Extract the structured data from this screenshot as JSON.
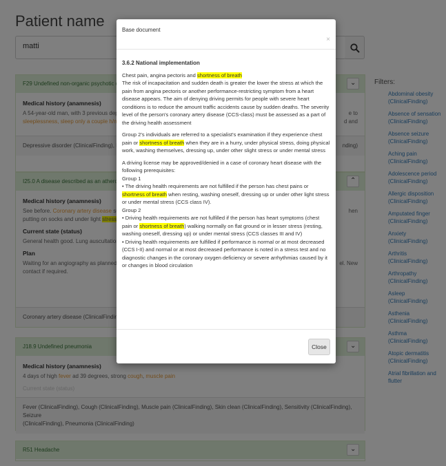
{
  "header": {
    "title": "Patient name"
  },
  "search": {
    "value": "matti"
  },
  "panels": [
    {
      "code": "F29 Undefined non-organic psychotic dis",
      "history_label": "Medical history (anamnesis)",
      "history_text_1": "A 54-year-old man, with 3 previous depre",
      "history_text_2": "sleeplessness, sleep only a couple h/nig",
      "history_tail_1": "e to",
      "history_tail_2": "d and",
      "findings_left": "Depressive disorder (ClinicalFinding), Ins",
      "findings_right": "nding)"
    },
    {
      "code": "I25.0 A disease described as an atheroc",
      "history_label": "Medical history (anamnesis)",
      "history_text_1a": "See before. ",
      "history_text_1b": "Coronary artery disease",
      "history_text_1c": " sus",
      "history_text_2a": "putting on socks and under light ",
      "history_text_2b": "stress",
      "history_text_2c": ". D",
      "history_tail_1": "hen",
      "status_label": "Current state (status)",
      "status_text": "General health good. Lung auscultation c",
      "plan_label": "Plan",
      "plan_text_1": "Waiting for an angiography as planned. S",
      "plan_text_2": "contact if required.",
      "plan_tail": "el. New",
      "findings_left": "Coronary artery disease (ClinicalFinding)"
    },
    {
      "code": "J18.9 Undefined pneumonia",
      "history_label": "Medical history (anamnesis)",
      "history_text_a": "4 days of high ",
      "history_text_fever": "fever",
      "history_text_b": " ad 39 degrees, strong ",
      "history_text_cough": "cough",
      "history_text_c": ", ",
      "history_text_muscle": "muscle pain",
      "status_label": "Current state (status)",
      "findings_1": "Fever (ClinicalFinding), Cough (ClinicalFinding), Muscle pain (ClinicalFinding), Skin clean (ClinicalFinding), Sensitivity (ClinicalFinding), Seizure",
      "findings_2": "(ClinicalFinding), Pneumonia (ClinicalFinding)"
    },
    {
      "code": "R51 Headache"
    }
  ],
  "filters": {
    "title": "Filters:",
    "items": [
      "Abdominal obesity (ClinicalFinding)",
      "Absence of sensation (ClinicalFinding)",
      "Absence seizure (ClinicalFinding)",
      "Aching pain (ClinicalFinding)",
      "Adolescence period (ClinicalFinding)",
      "Allergic disposition (ClinicalFinding)",
      "Amputated finger (ClinicalFinding)",
      "Anxiety (ClinicalFinding)",
      "Arthritis (ClinicalFinding)",
      "Arthropathy (ClinicalFinding)",
      "Asleep (ClinicalFinding)",
      "Asthenia (ClinicalFinding)",
      "Asthma (ClinicalFinding)",
      "Atopic dermatitis (ClinicalFinding)",
      "Atrial fibrillation and flutter"
    ]
  },
  "modal": {
    "title": "Base document",
    "close_x": "×",
    "section": "3.6.2 National implementation",
    "p1_a": "Chest pain, angina pectoris and ",
    "highlight": "shortness of breath",
    "p1_b": "The risk of incapacitation and sudden death is greater the lower the stress at which the pain from angina pectoris or another performance-restricting symptom from a heart disease appears. The aim of denying driving permits for people with severe heart conditions is to reduce the amount traffic accidents cause by sudden deaths. The severity level of the person's coronary artery disease (CCS-class) must be assessed as a part of the driving health assessment",
    "p2_a": "Group 2's individuals are referred to a specialist's examination if they experience chest pain or ",
    "p2_b": " when they are in a hurry, under physical stress, doing physical work, washing themselves, dressing up, under other slight stress or under mental stress",
    "p3": "A driving license may be approved/denied in a case of coronary heart disease with the following prerequisites:",
    "group1": "Group 1",
    "g1_a": "•     The driving health requirements are not fulfilled if the person has chest pains or ",
    "g1_b": " when resting, washing oneself, dressing up or under other light stress or under mental stress (CCS class IV).",
    "group2": "Group 2",
    "g2_a": "•     Driving health requirements are not fulfilled if the person has heart symptoms (chest pain or ",
    "g2_b": ") walking normally on flat ground or in lesser stress (resting, washing oneself, dressing up) or under mental stress (CCS classes III and IV)",
    "g2_c": "•     Driving health requirements are fulfilled if performance is normal or at most decreased (CCS I-II) and normal or at most decreased performance is noted in a stress test and no diagnostic changes in the coronary oxygen deficiency or severe arrhythmias caused by it or changes in blood circulation",
    "close_label": "Close"
  }
}
